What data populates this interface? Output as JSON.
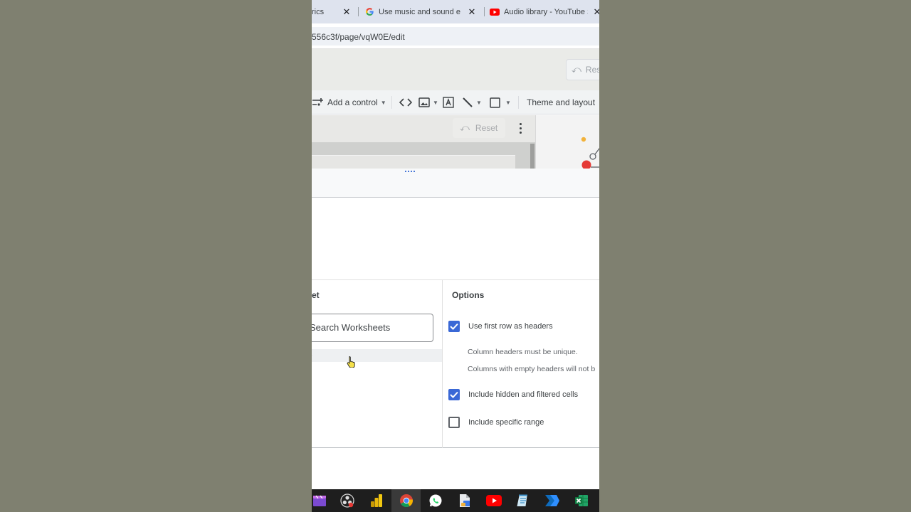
{
  "browser": {
    "tabs": [
      {
        "title": "rics",
        "favicon": "none",
        "close": "✕"
      },
      {
        "title": "Use music and sound effects",
        "favicon": "google-g-icon",
        "close": "✕"
      },
      {
        "title": "Audio library - YouTube Studio",
        "favicon": "youtube-icon",
        "close": "✕"
      }
    ],
    "url": "556c3f/page/vqW0E/edit"
  },
  "header": {
    "reset_top_label": "Res"
  },
  "toolbar": {
    "add_control_label": "Add a control",
    "theme_layout_label": "Theme and layout",
    "icons": [
      "add-control-icon",
      "embed-code-icon",
      "image-icon",
      "text-icon",
      "line-icon",
      "shape-icon"
    ]
  },
  "canvas": {
    "reset_label": "Reset"
  },
  "dialog": {
    "left_section_title": "et",
    "search_placeholder": "Search Worksheets",
    "options_title": "Options",
    "options": [
      {
        "label": "Use first row as headers",
        "checked": true
      },
      {
        "label": "Include hidden and filtered cells",
        "checked": true
      },
      {
        "label": "Include specific range",
        "checked": false
      }
    ],
    "notes": [
      "Column headers must be unique.",
      "Columns with empty headers will not b"
    ]
  },
  "taskbar": {
    "apps": [
      "clapper-icon",
      "obs-icon",
      "power-bi-icon",
      "chrome-icon",
      "whatsapp-icon",
      "file-icon",
      "youtube-icon",
      "notepad-icon",
      "power-automate-icon",
      "excel-icon"
    ],
    "active": "chrome-icon"
  },
  "colors": {
    "background": "#7f8070",
    "accent_blue": "#3a68d6",
    "tab_strip": "#dee3ee",
    "youtube_red": "#ff0000"
  }
}
